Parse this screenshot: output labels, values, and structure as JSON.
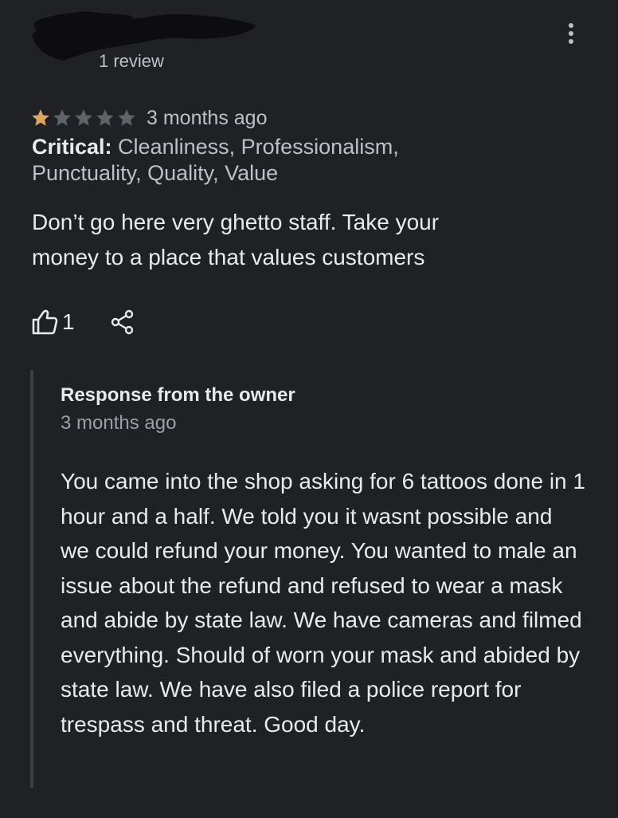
{
  "reviewer": {
    "review_count": "1 review"
  },
  "review": {
    "rating": 1,
    "max_rating": 5,
    "date": "3 months ago",
    "critical_label": "Critical:",
    "critical_items": "Cleanliness, Professionalism, Punctuality, Quality, Value",
    "text": "Don’t go here very ghetto staff. Take your money to a place that values customers",
    "like_count": "1"
  },
  "owner_response": {
    "title": "Response from the owner",
    "date": "3 months ago",
    "text": "You came into the shop asking for 6 tattoos done in 1 hour and a half. We told you it wasnt possible and we could refund your money. You wanted to male an issue about the refund and refused to wear a mask and abide by state law. We have cameras and filmed everything. Should of worn your mask and abided by state law. We have also filed a police report for trespass and threat. Good day."
  },
  "colors": {
    "background": "#202124",
    "star_filled": "#e3a55e",
    "star_empty": "#5f6368",
    "text_primary": "#e8eaed",
    "text_secondary": "#9aa0a6",
    "border": "#3c4043"
  },
  "icons": {
    "more": "more-vert-icon",
    "like": "thumbs-up-icon",
    "share": "share-icon",
    "star": "star-icon"
  }
}
